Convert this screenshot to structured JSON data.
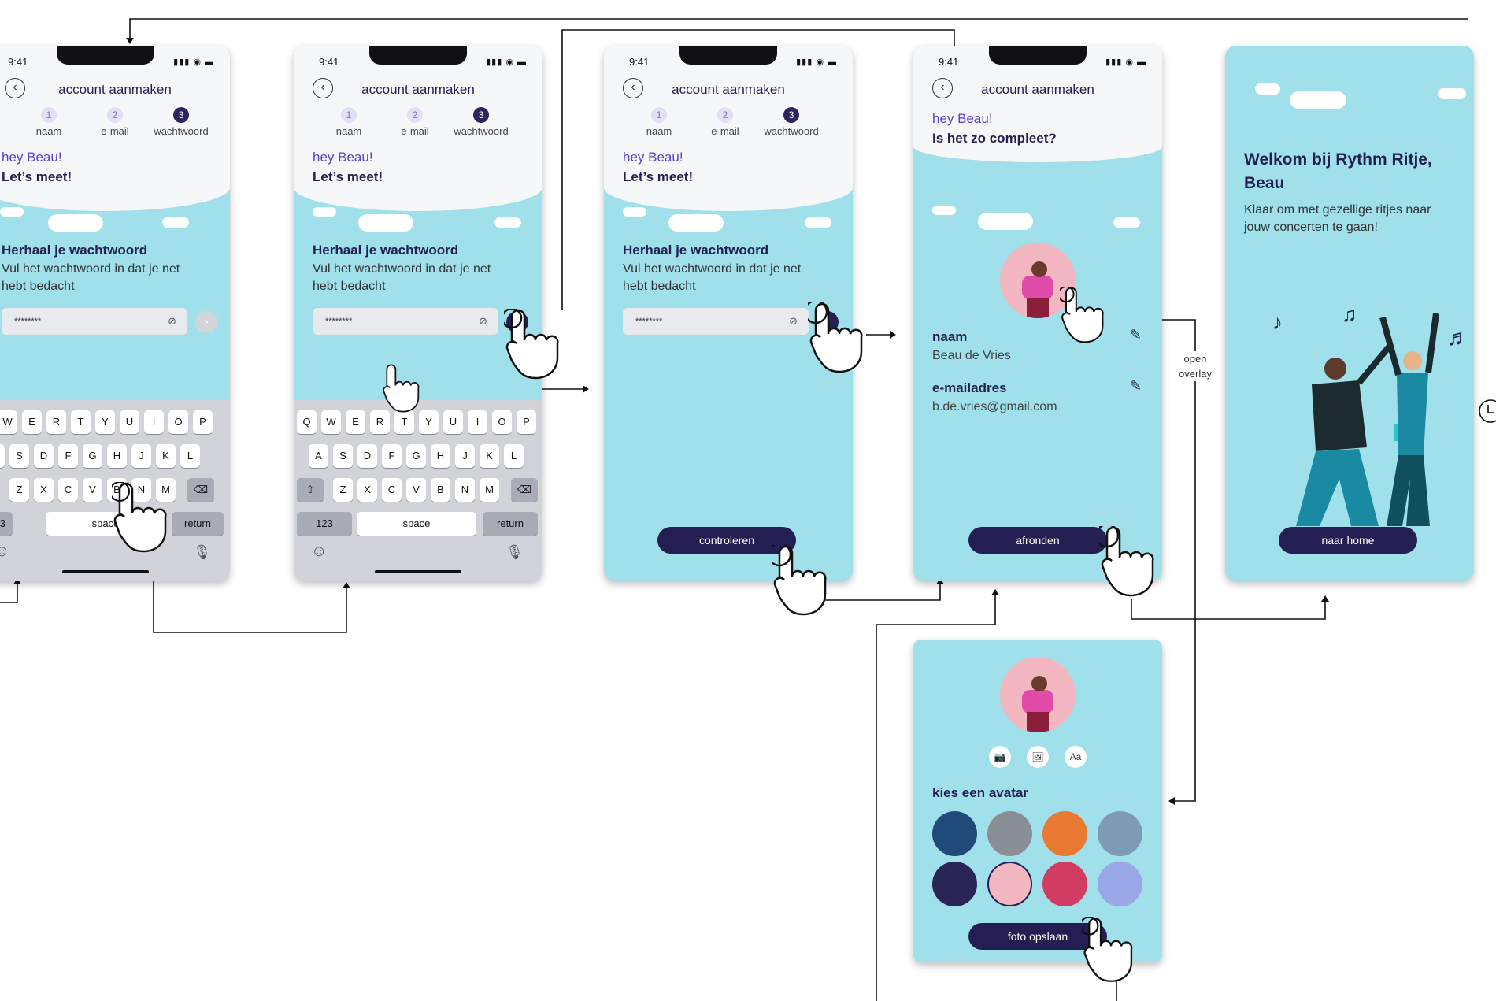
{
  "status": {
    "time": "9:41",
    "signal": "▮▮▮ ◉ ▬"
  },
  "screens": {
    "header_title": "account aanmaken",
    "steps": [
      {
        "num": "1",
        "label": "naam"
      },
      {
        "num": "2",
        "label": "e-mail"
      },
      {
        "num": "3",
        "label": "wachtwoord"
      }
    ],
    "greeting": "hey Beau!",
    "lets_meet": "Let’s meet!",
    "repeat_title": "Herhaal je wachtwoord",
    "repeat_desc": "Vul het wachtwoord in dat je net hebt bedacht",
    "password_mask": "********",
    "controleren": "controleren"
  },
  "keyboard": {
    "row1": [
      "Q",
      "W",
      "E",
      "R",
      "T",
      "Y",
      "U",
      "I",
      "O",
      "P"
    ],
    "row2": [
      "A",
      "S",
      "D",
      "F",
      "G",
      "H",
      "J",
      "K",
      "L"
    ],
    "row3": [
      "Z",
      "X",
      "C",
      "V",
      "B",
      "N",
      "M"
    ],
    "num": "123",
    "space": "space",
    "return": "return"
  },
  "profile": {
    "greeting": "hey Beau!",
    "question": "Is het zo compleet?",
    "name_label": "naam",
    "name_value": "Beau de Vries",
    "email_label": "e-mailadres",
    "email_value": "b.de.vries@gmail.com",
    "finish": "afronden"
  },
  "welcome": {
    "title": "Welkom bij Rythm Ritje, Beau",
    "text": "Klaar om met gezellige ritjes naar jouw concerten te gaan!",
    "button": "naar home"
  },
  "overlay": {
    "tools": [
      "📷",
      "🖼",
      "Aa"
    ],
    "choose": "kies een avatar",
    "save": "foto opslaan",
    "avatar_colors": [
      "#1f4a7a",
      "#8a8f96",
      "#e87a33",
      "#7e9bb5",
      "#2a2457",
      "#f3b7c2",
      "#d23b62",
      "#9aa7e6"
    ]
  },
  "annotation": {
    "open_overlay": "open overlay"
  },
  "colors": {
    "accent": "#241f52",
    "sky": "#9fe0ea",
    "purple": "#5a3fce",
    "pink": "#f3b7c2"
  }
}
